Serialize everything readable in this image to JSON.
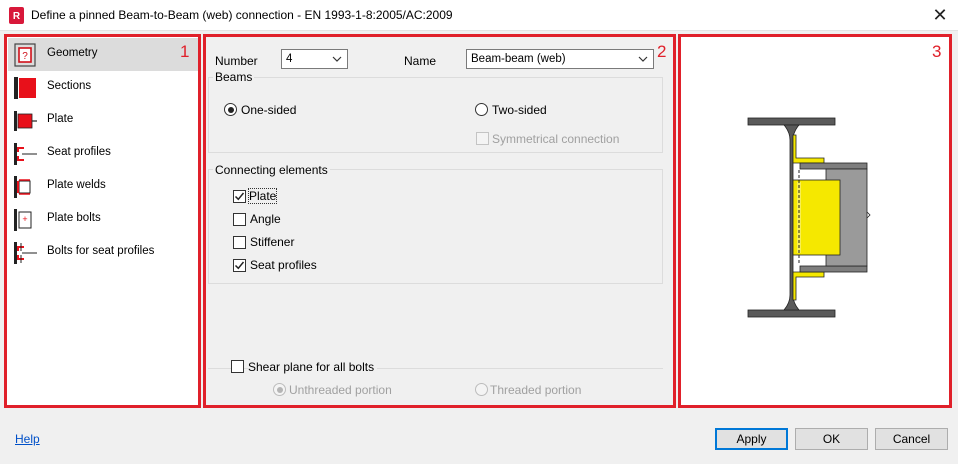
{
  "window": {
    "title": "Define a pinned Beam-to-Beam (web) connection - EN 1993-1-8:2005/AC:2009",
    "close_glyph": "✕",
    "app_icon": "robot-app-icon",
    "app_icon_letter": "R"
  },
  "nav": {
    "items": [
      {
        "label": "Geometry",
        "icon": "geometry-icon",
        "selected": true
      },
      {
        "label": "Sections",
        "icon": "sections-icon"
      },
      {
        "label": "Plate",
        "icon": "plate-icon"
      },
      {
        "label": "Seat profiles",
        "icon": "seat-profiles-icon"
      },
      {
        "label": "Plate welds",
        "icon": "plate-welds-icon"
      },
      {
        "label": "Plate bolts",
        "icon": "plate-bolts-icon"
      },
      {
        "label": "Bolts for seat profiles",
        "icon": "bolts-seat-profiles-icon"
      }
    ]
  },
  "annotations": {
    "box1": "1",
    "box2": "2",
    "box3": "3",
    "color": "#e0202a"
  },
  "form": {
    "number_label": "Number",
    "number_value": "4",
    "name_label": "Name",
    "name_value": "Beam-beam (web)",
    "beams": {
      "title": "Beams",
      "one_sided": "One-sided",
      "two_sided": "Two-sided",
      "symmetrical": "Symmetrical connection",
      "selected": "one_sided"
    },
    "connecting": {
      "title": "Connecting elements",
      "plate": "Plate",
      "angle": "Angle",
      "stiffener": "Stiffener",
      "seat_profiles": "Seat profiles",
      "plate_checked": true,
      "angle_checked": false,
      "stiffener_checked": false,
      "seat_profiles_checked": true
    },
    "shear_plane": {
      "label": "Shear plane for all bolts",
      "checked": false,
      "unthreaded": "Unthreaded portion",
      "threaded": "Threaded portion",
      "selected": "unthreaded"
    }
  },
  "footer": {
    "help": "Help",
    "apply": "Apply",
    "ok": "OK",
    "cancel": "Cancel"
  },
  "colors": {
    "steel": "#595959",
    "plate": "#f5e800",
    "seat": "#f5e800",
    "beam": "#8f8f8f"
  }
}
